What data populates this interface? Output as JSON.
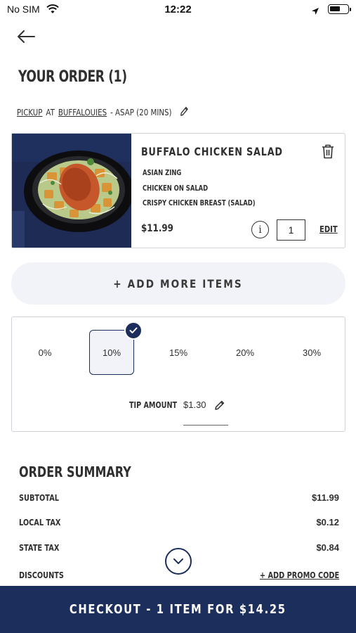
{
  "status_bar": {
    "carrier": "No SIM",
    "time": "12:22",
    "battery_level": 0.6
  },
  "header": {
    "back_icon": "arrow-left-icon",
    "title": "YOUR ORDER (1)"
  },
  "pickup": {
    "mode": "PICKUP",
    "at": "AT",
    "location": "BUFFALOUIES",
    "time": "- ASAP (20 MINS)",
    "edit_icon": "pencil-icon"
  },
  "order_item": {
    "name": "BUFFALO CHICKEN SALAD",
    "modifiers": [
      "ASIAN ZING",
      "CHICKEN ON SALAD",
      "CRISPY CHICKEN BREAST (SALAD)"
    ],
    "price": "$11.99",
    "info_symbol": "i",
    "quantity": "1",
    "edit_label": "EDIT",
    "delete_icon": "trash-icon",
    "image_icon": "salad-photo"
  },
  "add_more_label": "+ ADD MORE ITEMS",
  "tip": {
    "options": [
      "0%",
      "10%",
      "15%",
      "20%",
      "30%"
    ],
    "selected": "10%",
    "amount_label": "TIP AMOUNT",
    "amount_value": "$1.30"
  },
  "summary": {
    "title": "ORDER SUMMARY",
    "rows": [
      {
        "label": "SUBTOTAL",
        "value": "$11.99"
      },
      {
        "label": "LOCAL TAX",
        "value": "$0.12"
      },
      {
        "label": "STATE TAX",
        "value": "$0.84"
      }
    ],
    "discounts_label": "DISCOUNTS",
    "promo_label": "+ ADD PROMO CODE"
  },
  "checkout_label": "CHECKOUT - 1 ITEM FOR $14.25",
  "colors": {
    "brand_navy": "#1c2e5c",
    "pill_bg": "#f2f3f8",
    "border": "#cfd2d9"
  }
}
